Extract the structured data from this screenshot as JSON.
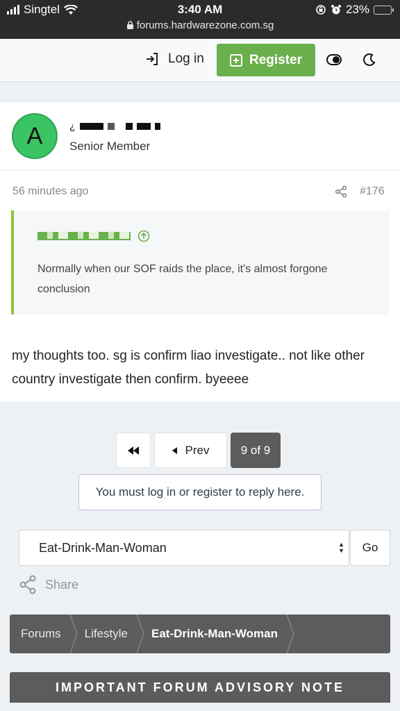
{
  "status_bar": {
    "carrier": "Singtel",
    "time": "3:40 AM",
    "battery_percent": "23%",
    "battery_level": 0.23,
    "url": "forums.hardwarezone.com.sg"
  },
  "header": {
    "login_label": "Log in",
    "register_label": "Register"
  },
  "post": {
    "avatar_letter": "A",
    "username_prefix": "¿",
    "user_title": "Senior Member",
    "timestamp": "56 minutes ago",
    "post_number": "#176",
    "quote": {
      "text": "Normally when our SOF raids the place, it's almost forgone conclusion"
    },
    "message": "my thoughts too. sg is confirm liao investigate.. not like other country investigate then confirm. byeeee"
  },
  "pagination": {
    "prev_label": "Prev",
    "current_label": "9 of 9"
  },
  "reply_notice": "You must log in or register to reply here.",
  "forum_jump": {
    "selected": "Eat-Drink-Man-Woman",
    "go_label": "Go"
  },
  "share_label": "Share",
  "breadcrumb": [
    "Forums",
    "Lifestyle",
    "Eat-Drink-Man-Woman"
  ],
  "advisory_title": "IMPORTANT FORUM ADVISORY NOTE",
  "colors": {
    "register_green": "#6ab04c",
    "avatar_green": "#3ac463",
    "quote_border": "#8dc63f",
    "dark_bar": "#5c5c5c"
  }
}
